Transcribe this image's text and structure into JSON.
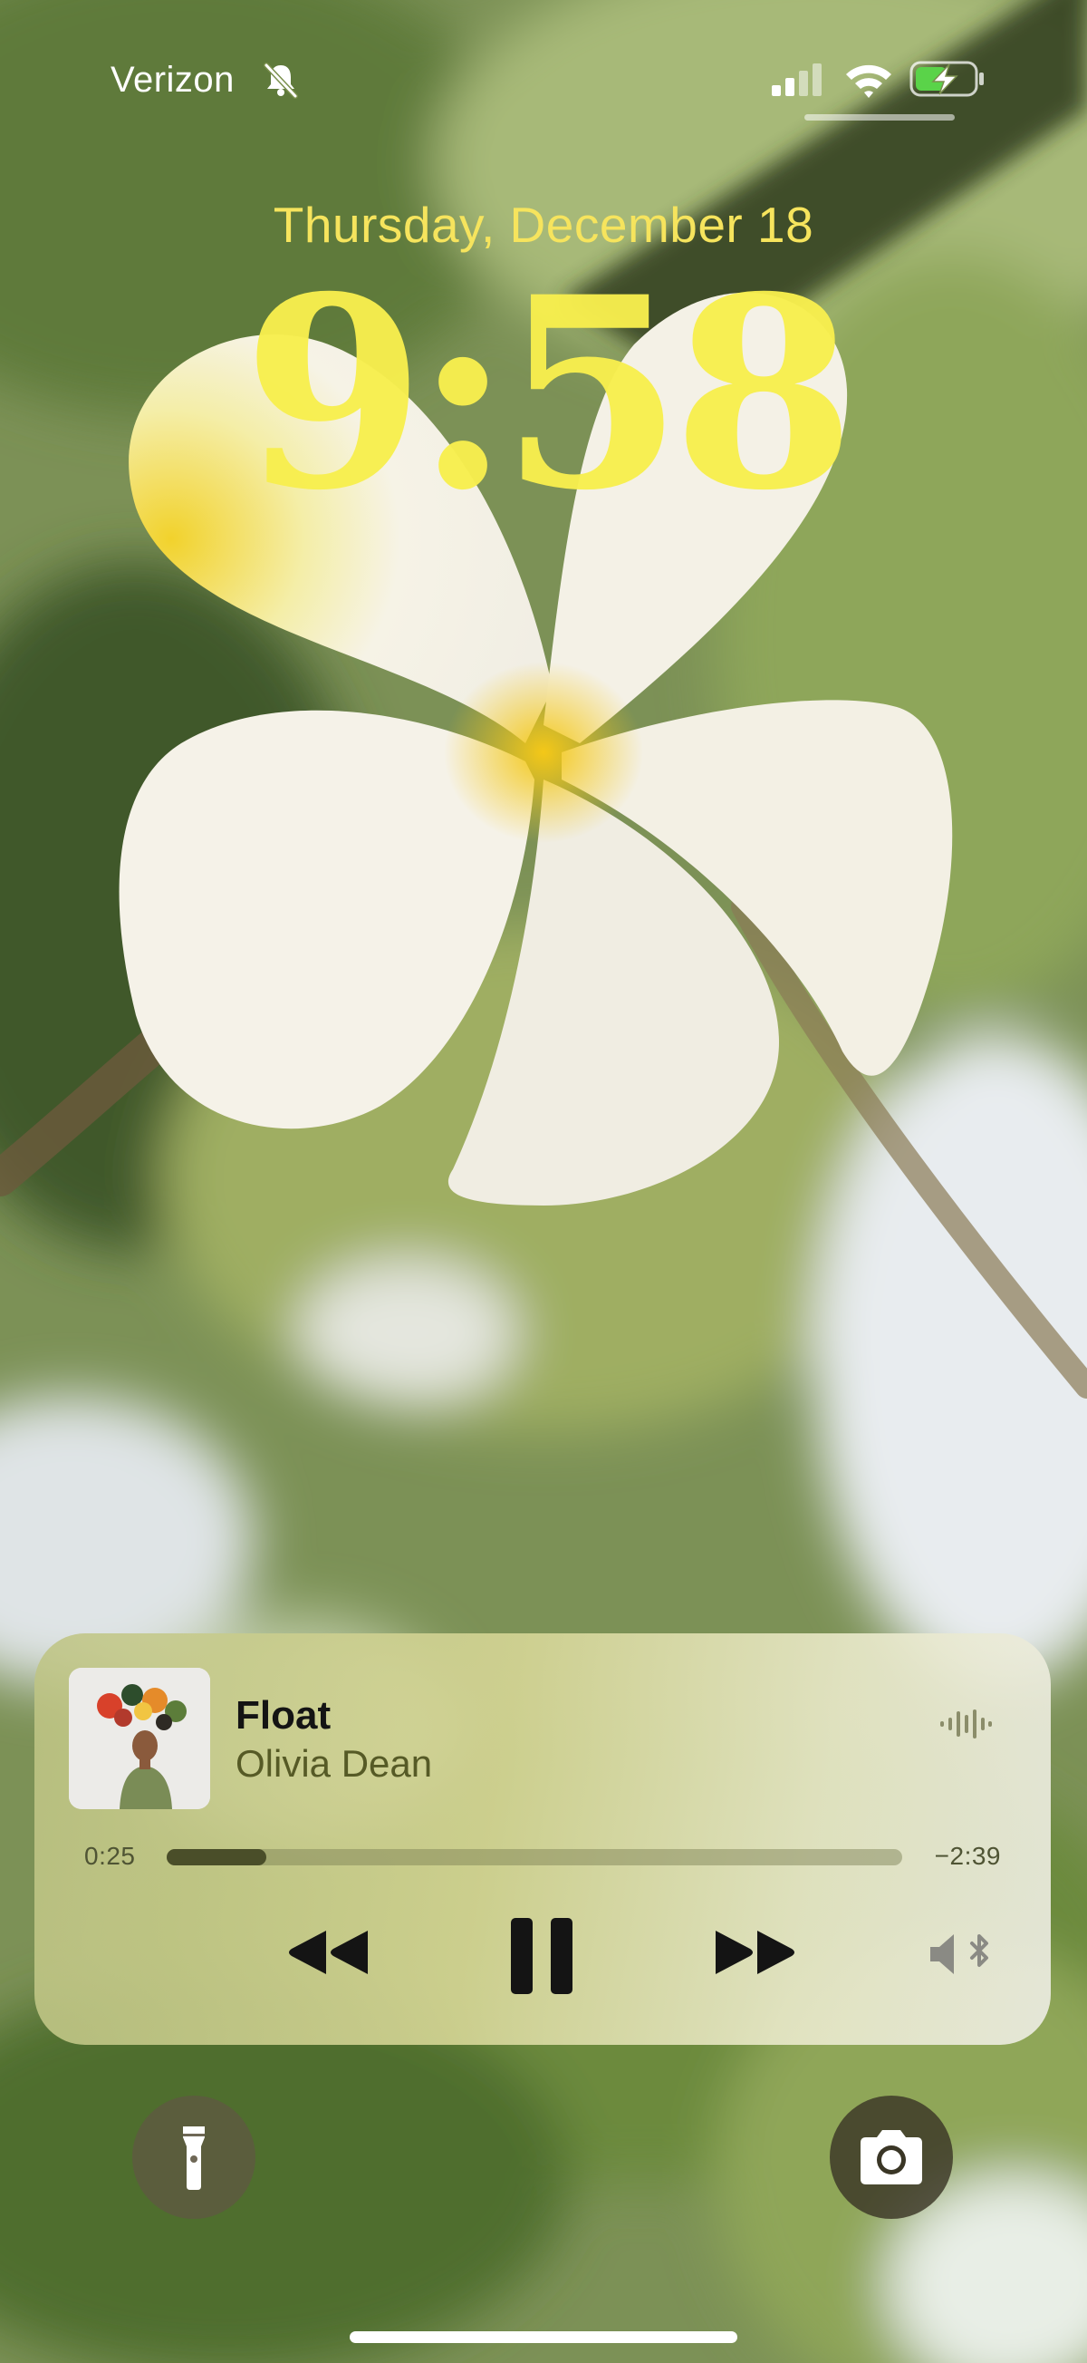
{
  "status_bar": {
    "carrier": "Verizon",
    "silent_icon": "bell-slash-icon",
    "signal_icon": "cellular-signal-icon",
    "wifi_icon": "wifi-icon",
    "battery_icon": "battery-charging-icon",
    "battery_color": "#5ad349"
  },
  "lock_screen": {
    "date": "Thursday, December 18",
    "time": "9:58",
    "accent_color": "#f8ef4e"
  },
  "now_playing": {
    "title": "Float",
    "artist": "Olivia Dean",
    "elapsed": "0:25",
    "remaining": "−2:39",
    "progress_fraction": 0.135,
    "album_art_icon": "album-art",
    "waveform_icon": "waveform-icon",
    "controls": {
      "rewind_icon": "rewind-icon",
      "pause_icon": "pause-icon",
      "forward_icon": "fast-forward-icon",
      "output_icon": "speaker-bluetooth-icon"
    }
  },
  "quick_actions": {
    "flashlight_icon": "flashlight-icon",
    "camera_icon": "camera-icon"
  }
}
